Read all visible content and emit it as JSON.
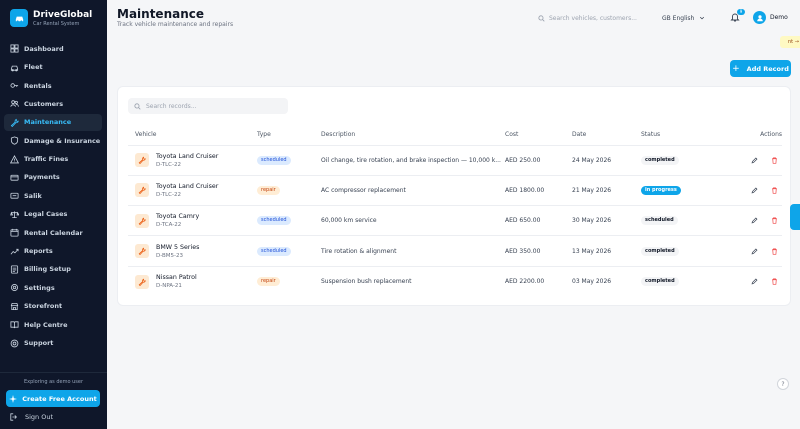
{
  "brand": {
    "name": "DriveGlobal",
    "subtitle": "Car Rental System"
  },
  "nav": {
    "items": [
      {
        "label": "Dashboard",
        "icon": "grid-icon"
      },
      {
        "label": "Fleet",
        "icon": "car-icon"
      },
      {
        "label": "Rentals",
        "icon": "key-icon"
      },
      {
        "label": "Customers",
        "icon": "users-icon"
      },
      {
        "label": "Maintenance",
        "icon": "wrench-icon",
        "active": true
      },
      {
        "label": "Damage & Insurance",
        "icon": "shield-icon"
      },
      {
        "label": "Traffic Fines",
        "icon": "alert-icon"
      },
      {
        "label": "Payments",
        "icon": "card-icon"
      },
      {
        "label": "Salik",
        "icon": "toll-icon"
      },
      {
        "label": "Legal Cases",
        "icon": "scale-icon"
      },
      {
        "label": "Rental Calendar",
        "icon": "calendar-icon"
      },
      {
        "label": "Reports",
        "icon": "chart-icon"
      },
      {
        "label": "Billing Setup",
        "icon": "billing-icon"
      },
      {
        "label": "Settings",
        "icon": "gear-icon"
      },
      {
        "label": "Storefront",
        "icon": "store-icon"
      },
      {
        "label": "Help Centre",
        "icon": "book-icon"
      },
      {
        "label": "Support",
        "icon": "support-icon"
      }
    ]
  },
  "sidebar_footer": {
    "demo_note": "Exploring as demo user",
    "create_label": "Create Free Account",
    "signout_label": "Sign Out"
  },
  "header": {
    "title": "Maintenance",
    "subtitle": "Track vehicle maintenance and repairs",
    "search_placeholder": "Search vehicles, customers...",
    "language": "GB English",
    "notification_count": "9",
    "user_name": "Demo",
    "chip_text": "nt →"
  },
  "toolbar": {
    "add_label": "Add Record"
  },
  "records": {
    "search_placeholder": "Search records...",
    "columns": [
      "Vehicle",
      "Type",
      "Description",
      "Cost",
      "Date",
      "Status",
      "Actions"
    ],
    "rows": [
      {
        "vehicle": "Toyota Land Cruiser",
        "plate": "D-TLC-22",
        "type": "scheduled",
        "description": "Oil change, tire rotation, and brake inspection — 10,000 k...",
        "cost": "AED 250.00",
        "date": "24 May 2026",
        "status": "completed"
      },
      {
        "vehicle": "Toyota Land Cruiser",
        "plate": "D-TLC-22",
        "type": "repair",
        "description": "AC compressor replacement",
        "cost": "AED 1800.00",
        "date": "21 May 2026",
        "status": "in progress"
      },
      {
        "vehicle": "Toyota Camry",
        "plate": "D-TCA-22",
        "type": "scheduled",
        "description": "60,000 km service",
        "cost": "AED 650.00",
        "date": "30 May 2026",
        "status": "scheduled"
      },
      {
        "vehicle": "BMW 5 Series",
        "plate": "D-BM5-23",
        "type": "scheduled",
        "description": "Tire rotation & alignment",
        "cost": "AED 350.00",
        "date": "13 May 2026",
        "status": "completed"
      },
      {
        "vehicle": "Nissan Patrol",
        "plate": "D-NPA-21",
        "type": "repair",
        "description": "Suspension bush replacement",
        "cost": "AED 2200.00",
        "date": "03 May 2026",
        "status": "completed"
      }
    ]
  },
  "help": {
    "label": "?"
  },
  "colors": {
    "accent": "#0ea5e9",
    "sidebar_bg": "#0f172a",
    "danger": "#ef4444",
    "repair": "#c2410c"
  }
}
